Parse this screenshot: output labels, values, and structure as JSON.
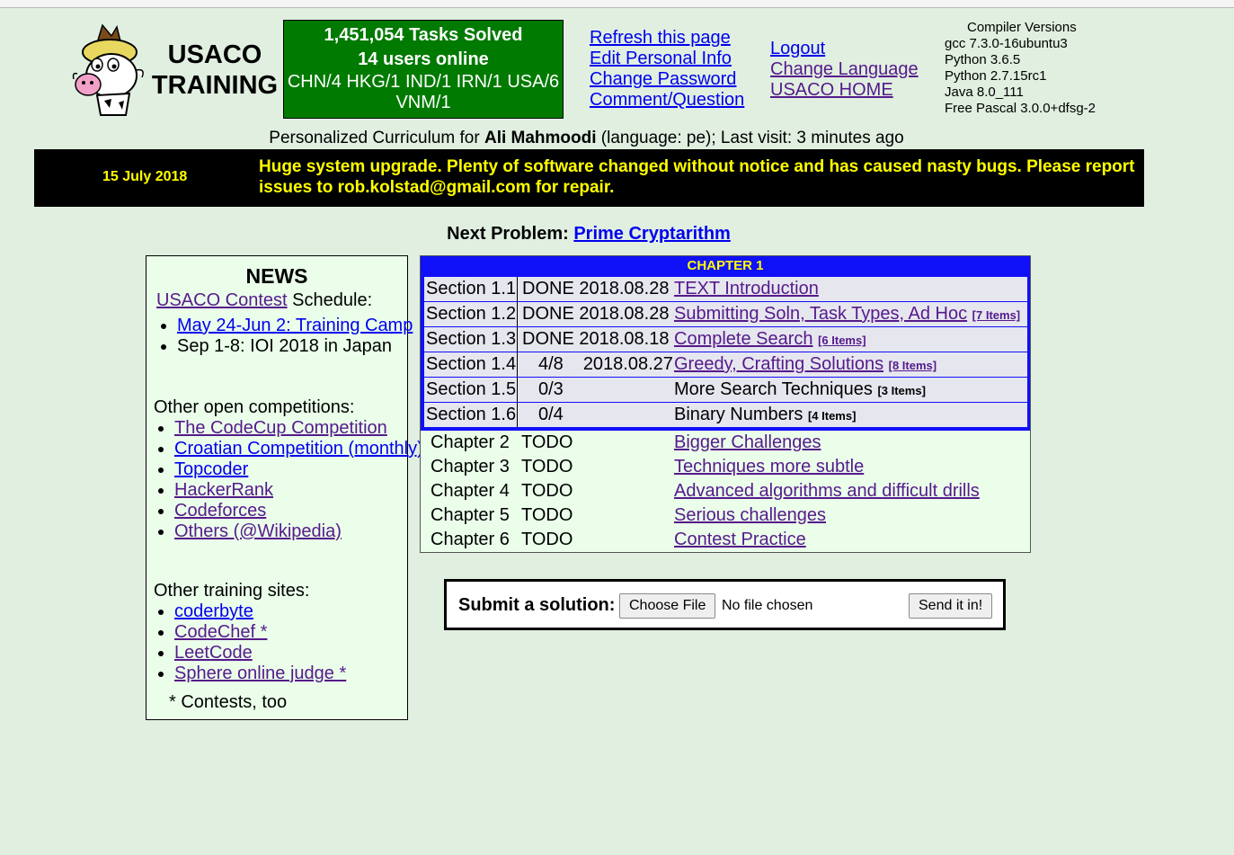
{
  "header": {
    "brand_line1": "USACO",
    "brand_line2": "TRAINING",
    "stats": {
      "tasks": "1,451,054 Tasks Solved",
      "users": "14 users online",
      "countries": "CHN/4 HKG/1 IND/1 IRN/1 USA/6 VNM/1"
    },
    "links_left": [
      "Refresh this page",
      "Edit Personal Info",
      "Change Password",
      "Comment/Question"
    ],
    "links_right": [
      "Logout",
      "Change Language",
      "USACO HOME"
    ],
    "compilers": {
      "title": "Compiler Versions",
      "items": [
        "gcc 7.3.0-16ubuntu3",
        "Python 3.6.5",
        "Python 2.7.15rc1",
        "Java 8.0_111",
        "Free Pascal 3.0.0+dfsg-2"
      ]
    }
  },
  "personal": {
    "prefix": "Personalized Curriculum for ",
    "name": "Ali Mahmoodi",
    "suffix": " (language: pe); Last visit: 3 minutes ago"
  },
  "banner": {
    "date": "15 July 2018",
    "message": "Huge system upgrade. Plenty of software changed without notice and has caused nasty bugs. Please report issues to rob.kolstad@gmail.com for repair."
  },
  "next_problem": {
    "label": "Next Problem: ",
    "link": "Prime Cryptarithm"
  },
  "news": {
    "title": "NEWS",
    "contest_link": "USACO Contest",
    "schedule_suffix": " Schedule:",
    "schedule": [
      {
        "text": "May 24-Jun 2: Training Camp",
        "link": true
      },
      {
        "text": "Sep 1-8: IOI 2018 in Japan",
        "link": false
      }
    ],
    "other_comp_title": "Other open competitions:",
    "other_comp": [
      "The CodeCup Competition",
      "Croatian Competition (monthly)",
      "Topcoder",
      "HackerRank",
      "Codeforces",
      "Others (@Wikipedia)"
    ],
    "training_title": "Other training sites:",
    "training": [
      "coderbyte",
      "CodeChef *",
      "LeetCode",
      "Sphere online judge *"
    ],
    "footnote": "* Contests, too"
  },
  "chapter1": {
    "title": "CHAPTER 1",
    "sections": [
      {
        "section": "Section 1.1",
        "status": "DONE",
        "date": "2018.08.28",
        "title": "TEXT Introduction",
        "items": "",
        "link": true
      },
      {
        "section": "Section 1.2",
        "status": "DONE",
        "date": "2018.08.28",
        "title": "Submitting Soln, Task Types, Ad Hoc",
        "items": "[7 Items]",
        "link": true
      },
      {
        "section": "Section 1.3",
        "status": "DONE",
        "date": "2018.08.18",
        "title": "Complete Search",
        "items": "[6 Items]",
        "link": true
      },
      {
        "section": "Section 1.4",
        "status": "4/8",
        "date": "2018.08.27",
        "title": "Greedy, Crafting Solutions",
        "items": "[8 Items]",
        "link": true
      },
      {
        "section": "Section 1.5",
        "status": "0/3",
        "date": "",
        "title": "More Search Techniques",
        "items": "[3 Items]",
        "link": false
      },
      {
        "section": "Section 1.6",
        "status": "0/4",
        "date": "",
        "title": "Binary Numbers",
        "items": "[4 Items]",
        "link": false
      }
    ]
  },
  "chapters": [
    {
      "chapter": "Chapter 2",
      "status": "TODO",
      "title": "Bigger Challenges"
    },
    {
      "chapter": "Chapter 3",
      "status": "TODO",
      "title": "Techniques more subtle"
    },
    {
      "chapter": "Chapter 4",
      "status": "TODO",
      "title": "Advanced algorithms and difficult drills"
    },
    {
      "chapter": "Chapter 5",
      "status": "TODO",
      "title": "Serious challenges"
    },
    {
      "chapter": "Chapter 6",
      "status": "TODO",
      "title": "Contest Practice"
    }
  ],
  "submit": {
    "label": "Submit a solution:",
    "choose_file": "Choose File",
    "no_file": "No file chosen",
    "send": "Send it in!"
  },
  "colors": {
    "page_bg": "#e0efe0",
    "stats_bg": "#007a00",
    "chapter_border": "#1010f8",
    "banner_text": "#ffff00"
  }
}
